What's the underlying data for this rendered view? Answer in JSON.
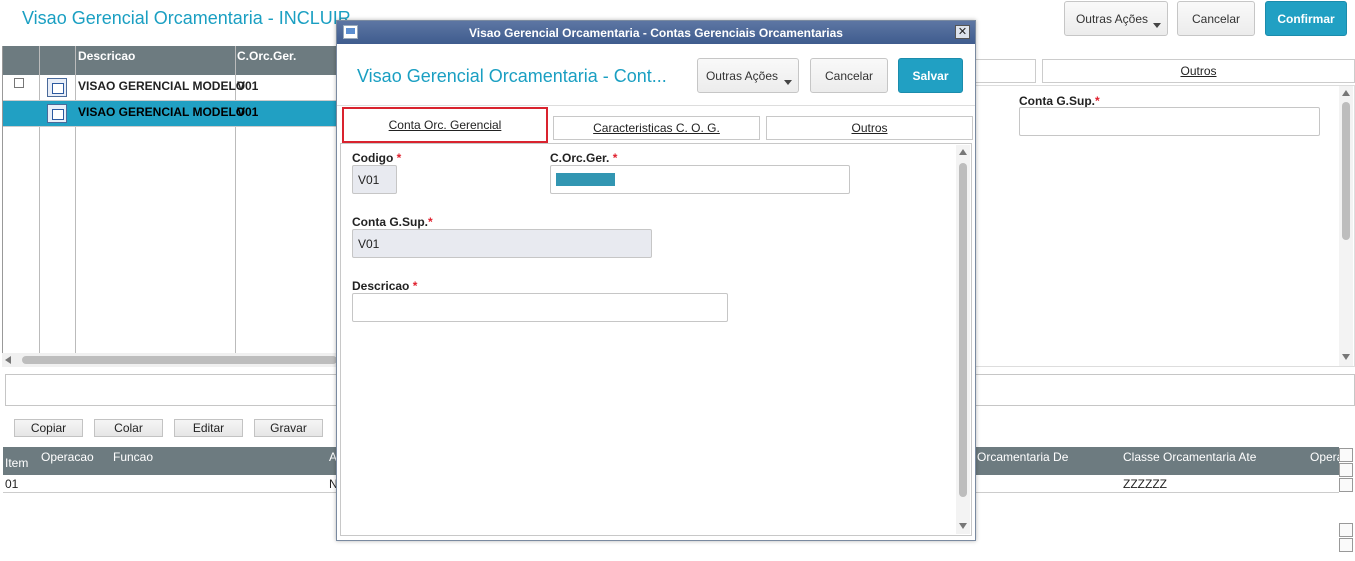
{
  "background": {
    "title": "Visao Gerencial Orcamentaria - INCLUIR",
    "buttons": {
      "other_actions": "Outras Ações",
      "cancel": "Cancelar",
      "confirm": "Confirmar"
    },
    "grid": {
      "columns": [
        "Descricao",
        "C.Orc.Ger."
      ],
      "rows": [
        {
          "descricao": "VISAO GERENCIAL MODELO",
          "corcger": "V01"
        },
        {
          "descricao": "VISAO GERENCIAL MODELO",
          "corcger": "V01"
        }
      ]
    },
    "right_tab": "Outros",
    "right_field_label": "Conta G.Sup.",
    "toolbar": {
      "copy": "Copiar",
      "paste": "Colar",
      "edit": "Editar",
      "save": "Gravar"
    },
    "grid2": {
      "columns": [
        "Item",
        "Operacao",
        "Funcao",
        "A",
        "Orcamentaria De",
        "Classe Orcamentaria Ate",
        "Opera"
      ],
      "row": {
        "item": "01",
        "a": "N",
        "classe_ate": "ZZZZZZ"
      }
    }
  },
  "modal": {
    "window_title": "Visao Gerencial Orcamentaria - Contas Gerenciais Orcamentarias",
    "title": "Visao Gerencial Orcamentaria - Cont...",
    "buttons": {
      "other_actions": "Outras Ações",
      "cancel": "Cancelar",
      "save": "Salvar"
    },
    "tabs": [
      "Conta Orc. Gerencial",
      "Caracteristicas C. O. G.",
      "Outros"
    ],
    "fields": {
      "codigo": {
        "label": "Codigo",
        "value": "V01"
      },
      "corcger": {
        "label": "C.Orc.Ger.",
        "value": ""
      },
      "conta_gsup": {
        "label": "Conta G.Sup.",
        "value": "V01"
      },
      "descricao": {
        "label": "Descricao",
        "value": ""
      }
    },
    "required_mark": "*"
  },
  "colors": {
    "accent": "#21a0c3",
    "title": "#1a9fc2",
    "required": "#e0202e",
    "grid_header": "#6d7b80",
    "titlebar": "#4a6699"
  }
}
